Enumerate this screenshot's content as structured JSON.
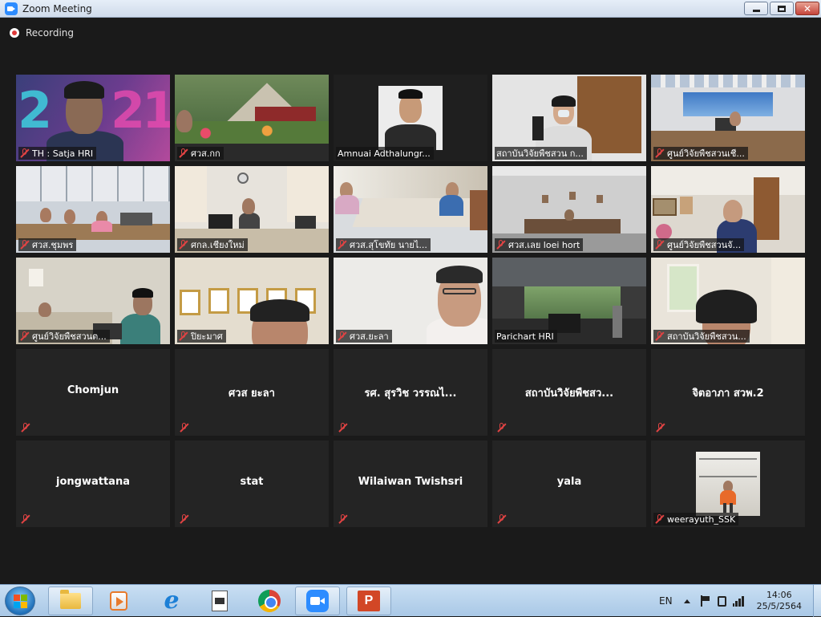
{
  "window": {
    "title": "Zoom Meeting",
    "close_glyph": "✕"
  },
  "recording": {
    "label": "Recording"
  },
  "tiles": [
    {
      "name": "TH : Satja HRI",
      "video": true
    },
    {
      "name": "ศวส.กก",
      "video": true
    },
    {
      "name": "Amnuai Adthalungr...",
      "video": true
    },
    {
      "name": "สถาบันวิจัยพืชสวน ก...",
      "video": true,
      "active": true
    },
    {
      "name": "ศูนย์วิจัยพืชสวนเชี...",
      "video": true
    },
    {
      "name": "ศวส.ชุมพร",
      "video": true
    },
    {
      "name": "ศกล.เชียงใหม่",
      "video": true
    },
    {
      "name": "ศวส.สุโขทัย นายไ...",
      "video": true
    },
    {
      "name": "ศวส.เลย loei hort",
      "video": true
    },
    {
      "name": "ศูนย์วิจัยพืชสวนจั...",
      "video": true
    },
    {
      "name": "ศูนย์วิจัยพืชสวนต...",
      "video": true
    },
    {
      "name": "ปิยะมาศ",
      "video": true
    },
    {
      "name": "ศวส.ยะลา",
      "video": true
    },
    {
      "name": "Parichart HRI",
      "video": true
    },
    {
      "name": "สถาบันวิจัยพืชสวน...",
      "video": true
    },
    {
      "name": "Chomjun",
      "video": false
    },
    {
      "name": "ศวส ยะลา",
      "video": false
    },
    {
      "name": "รศ. สุรวิช วรรณไ...",
      "video": false
    },
    {
      "name": "สถาบันวิจัยพืชสว...",
      "video": false
    },
    {
      "name": "จิตอาภา สวพ.2",
      "video": false
    },
    {
      "name": "jongwattana",
      "video": false
    },
    {
      "name": "stat",
      "video": false
    },
    {
      "name": "Wilaiwan Twishsri",
      "video": false
    },
    {
      "name": "yala",
      "video": false
    },
    {
      "name": "weerayuth_SSK",
      "video": true
    }
  ],
  "taskbar": {
    "language": "EN",
    "time": "14:06",
    "date": "25/5/2564",
    "ppt_letter": "P",
    "ie_letter": "e"
  }
}
